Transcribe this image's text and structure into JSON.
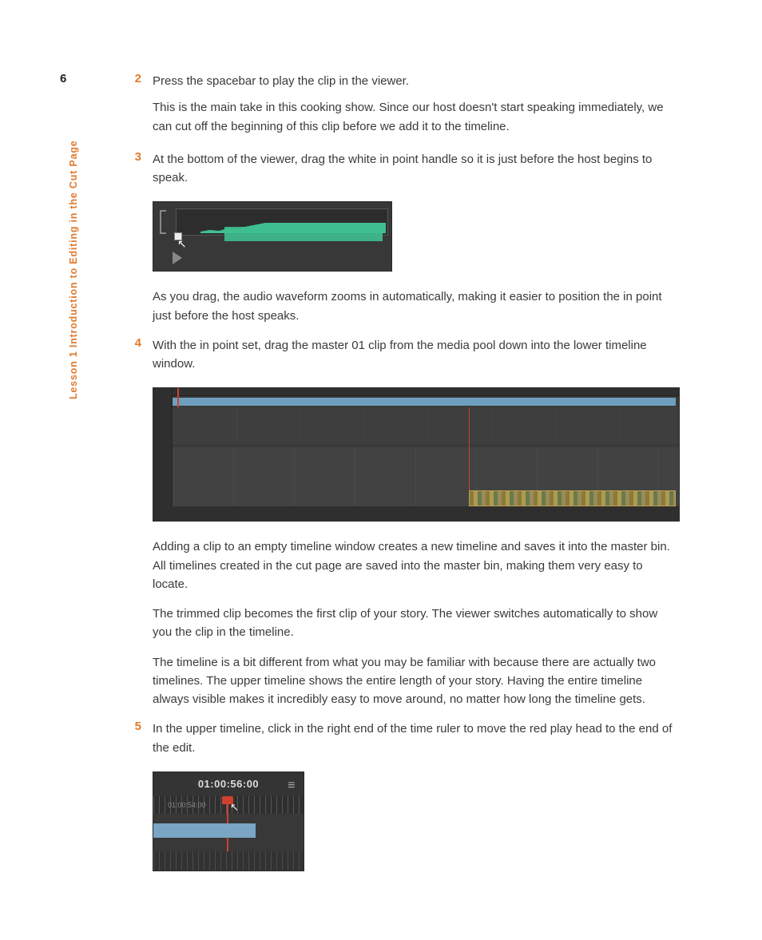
{
  "page_number": "6",
  "sidebar": "Lesson 1    Introduction to Editing in the Cut Page",
  "steps": {
    "s2": {
      "num": "2",
      "p1": "Press the spacebar to play the clip in the viewer.",
      "p2": "This is the main take in this cooking show. Since our host doesn't start speaking immediately, we can cut off the beginning of this clip before we add it to the timeline."
    },
    "s3": {
      "num": "3",
      "p1": "At the bottom of the viewer, drag the white in point handle so it is just before the host begins to speak."
    },
    "after3": "As you drag, the audio waveform zooms in automatically, making it easier to position the in point just before the host speaks.",
    "s4": {
      "num": "4",
      "p1": "With the in point set, drag the master 01 clip from the media pool down into the lower timeline window."
    },
    "after4_a": "Adding a clip to an empty timeline window creates a new timeline and saves it into the master bin. All timelines created in the cut page are saved into the master bin, making them very easy to locate.",
    "after4_b": "The trimmed clip becomes the first clip of your story. The viewer switches automatically to show you the clip in the timeline.",
    "after4_c": "The timeline is a bit different from what you may be familiar with because there are actually two timelines. The upper timeline shows the entire length of your story. Having the entire timeline always visible makes it incredibly easy to move around, no matter how long the timeline gets.",
    "s5": {
      "num": "5",
      "p1": "In the upper timeline, click in the right end of the time ruler to move the red play head to the end of the edit."
    }
  },
  "fig3": {
    "timecode": "01:00:56:00",
    "ruler_label": "01:00:54:00"
  }
}
